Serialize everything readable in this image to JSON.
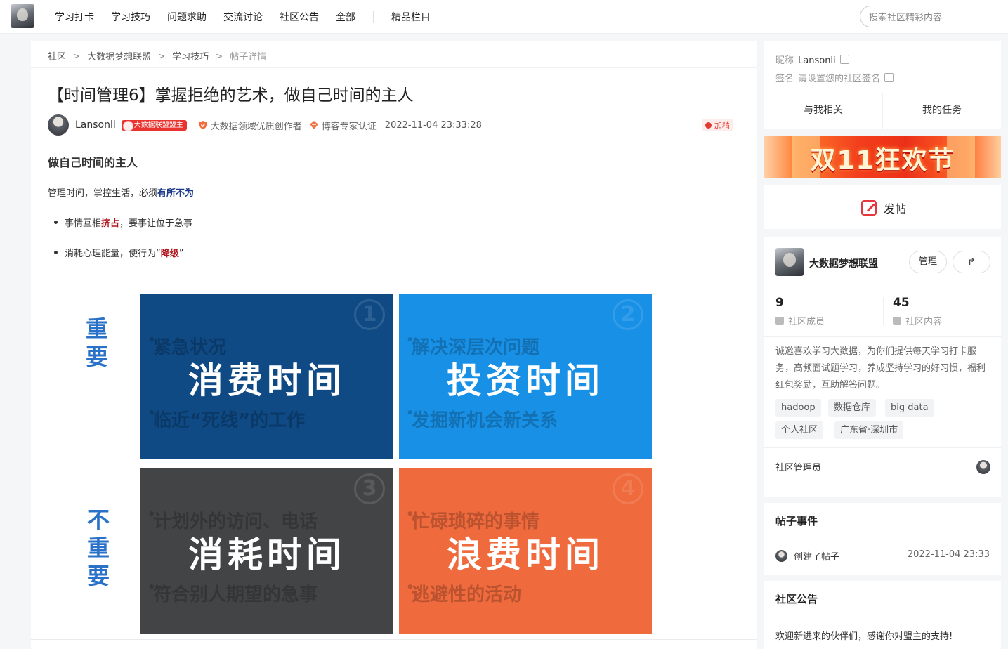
{
  "nav": {
    "items": [
      "学习打卡",
      "学习技巧",
      "问题求助",
      "交流讨论",
      "社区公告",
      "全部"
    ],
    "featured": "精品栏目",
    "search_placeholder": "搜索社区精彩内容"
  },
  "breadcrumb": [
    "社区",
    "大数据梦想联盟",
    "学习技巧",
    "帖子详情"
  ],
  "post": {
    "title": "【时间管理6】掌握拒绝的艺术，做自己时间的主人",
    "author": "Lansonli",
    "owner_badge": "大数据联盟盟主",
    "creator_badge": "大数据领域优质创作者",
    "expert_badge": "博客专家认证",
    "time": "2022-11-04 23:33:28",
    "jiajing": "加精",
    "heading": "做自己时间的主人",
    "para_prefix": "管理时间，掌控生活，必须",
    "para_bold": "有所不为",
    "bullets": [
      {
        "prefix": "事情互相",
        "bold": "挤占",
        "suffix": "，要事让位于急事"
      },
      {
        "prefix": "消耗心理能量，使行为“",
        "bold": "降级",
        "suffix": "”"
      }
    ]
  },
  "matrix": {
    "row_labels": [
      "重要",
      "不重要"
    ],
    "quadrants": [
      {
        "num": "1",
        "big": "消费时间",
        "ghost": [
          "紧急状况",
          "",
          "临近“死线”的工作"
        ]
      },
      {
        "num": "2",
        "big": "投资时间",
        "ghost": [
          "解决深层次问题",
          "",
          "发掘新机会新关系"
        ]
      },
      {
        "num": "3",
        "big": "消耗时间",
        "ghost": [
          "计划外的访问、电话",
          "",
          "符合别人期望的急事"
        ]
      },
      {
        "num": "4",
        "big": "浪费时间",
        "ghost": [
          "忙碌琐碎的事情",
          "",
          "逃避性的活动"
        ]
      }
    ],
    "colors": [
      "#0f4a84",
      "#1890e6",
      "#434446",
      "#ef6a3d"
    ]
  },
  "profile": {
    "nick_label": "昵称",
    "nick": "Lansonli",
    "sign_label": "签名",
    "sign": "请设置您的社区签名",
    "tabs": [
      "与我相关",
      "我的任务"
    ]
  },
  "banner": {
    "text": "双11狂欢节"
  },
  "post_button": "发帖",
  "community": {
    "name": "大数据梦想联盟",
    "manage": "管理",
    "members": "9",
    "members_label": "社区成员",
    "contents": "45",
    "contents_label": "社区内容",
    "desc": "诚邀喜欢学习大数据，为你们提供每天学习打卡服务，高频面试题学习，养成坚持学习的好习惯，福利红包奖励，互助解答问题。",
    "tags": [
      "hadoop",
      "数据仓库",
      "big data",
      "个人社区",
      "广东省·深圳市"
    ],
    "admin_label": "社区管理员"
  },
  "events": {
    "title": "帖子事件",
    "text": "创建了帖子",
    "time": "2022-11-04 23:33"
  },
  "notice": {
    "title": "社区公告",
    "text": "欢迎新进来的伙伴们，感谢你对盟主的支持!"
  },
  "accent": "#e6363b"
}
